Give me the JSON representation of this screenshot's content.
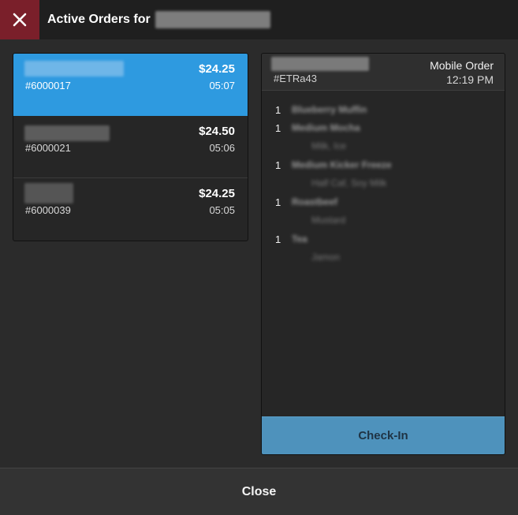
{
  "header": {
    "close_icon": "x-icon",
    "title": "Active Orders for"
  },
  "orders": [
    {
      "price": "$24.25",
      "number": "#6000017",
      "time": "05:07",
      "selected": true
    },
    {
      "price": "$24.50",
      "number": "#6000021",
      "time": "05:06",
      "selected": false
    },
    {
      "price": "$24.25",
      "number": "#6000039",
      "time": "05:05",
      "selected": false
    }
  ],
  "detail": {
    "order_code": "#ETRa43",
    "order_type": "Mobile Order",
    "order_time": "12:19 PM",
    "items": [
      {
        "qty": "1",
        "name": "Blueberry Muffin",
        "modifiers": []
      },
      {
        "qty": "1",
        "name": "Medium Mocha",
        "modifiers": [
          "Milk, Ice"
        ]
      },
      {
        "qty": "1",
        "name": "Medium Kicker Freeze",
        "modifiers": [
          "Half Caf, Soy Milk"
        ]
      },
      {
        "qty": "1",
        "name": "Roastbeef",
        "modifiers": [
          "Mustard"
        ]
      },
      {
        "qty": "1",
        "name": "Tea",
        "modifiers": [
          "Jamon"
        ]
      }
    ],
    "checkin_label": "Check-In"
  },
  "footer": {
    "close_label": "Close"
  },
  "colors": {
    "close_accent": "#7a1f2a",
    "selected_order": "#2e9ae0",
    "checkin_button": "#4e92bc",
    "background": "#2b2b2b"
  }
}
